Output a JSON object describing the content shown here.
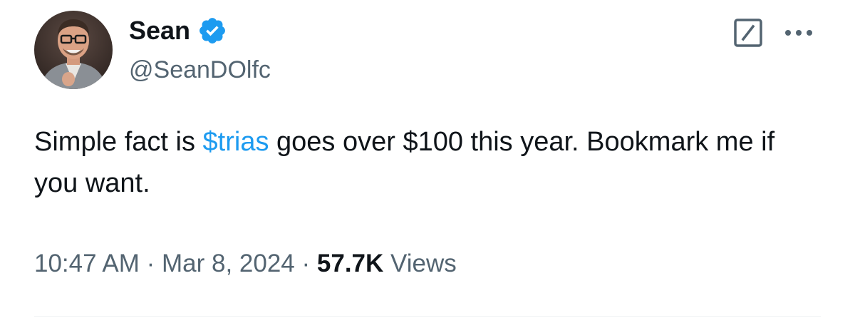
{
  "author": {
    "display_name": "Sean",
    "handle": "@SeanDOlfc",
    "avatar_icon": "profile-photo",
    "verified_icon": "verified-badge-icon",
    "verified_color": "#1d9bf0"
  },
  "actions": {
    "grok_icon": "grok-icon",
    "more_icon": "more-horizontal-icon"
  },
  "tweet": {
    "text_before": "Simple fact is ",
    "cashtag": "$trias",
    "text_after": " goes over $100 this year. Bookmark me if you want.",
    "cashtag_color": "#1d9bf0"
  },
  "meta": {
    "time": "10:47 AM",
    "separator": " · ",
    "date": "Mar 8, 2024",
    "views_count": "57.7K",
    "views_label": " Views"
  }
}
